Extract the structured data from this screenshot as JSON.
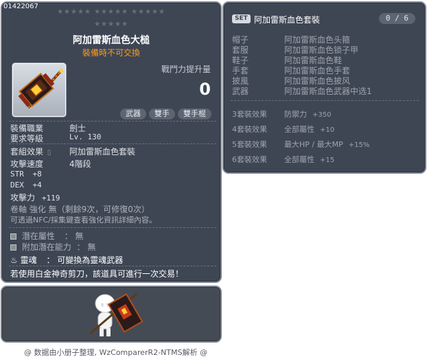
{
  "item": {
    "code": "01422067",
    "stars_row1": "★★★★★ ★★★★★ ★★★★★",
    "stars_row2": "★★★★★",
    "name": "阿加雷斯血色大槌",
    "trade_note": "裝備時不可交換",
    "power_label": "戰鬥力提升量",
    "power_value": "0",
    "tags": [
      "武器",
      "雙手",
      "雙手棍"
    ],
    "job_label": "裝備職業",
    "job_value": "劍士",
    "level_label": "要求等級",
    "level_value": "Lv. 130",
    "set_label": "套組效果",
    "set_value": "阿加雷斯血色套裝",
    "speed_label": "攻擊速度",
    "speed_value": "4階段",
    "str_label": "STR",
    "str_value": "+8",
    "dex_label": "DEX",
    "dex_value": "+4",
    "atk_label": "攻擊力",
    "atk_value": "+119",
    "scroll_note": "卷軸 強化 無（剩餘9次，可修復0次）",
    "enhance_note": "可透過NFC/採集鍵查看強化資訊詳細內容。",
    "potential_label": "潛在屬性",
    "potential_value": "： 無",
    "add_potential_label": "附加潛在能力",
    "add_potential_value": "： 無",
    "soul_label": "靈魂",
    "soul_value": "： 可變換為靈魂武器",
    "scissors_note": "若使用白金神奇剪刀，該道具可進行一次交易！"
  },
  "set": {
    "badge": "SET",
    "title": "阿加雷斯血色套裝",
    "count": "0 / 6",
    "parts": [
      {
        "slot": "帽子",
        "name": "阿加雷斯血色头箍"
      },
      {
        "slot": "套服",
        "name": "阿加雷斯血色锁子甲"
      },
      {
        "slot": "鞋子",
        "name": "阿加雷斯血色鞋"
      },
      {
        "slot": "手套",
        "name": "阿加雷斯血色手套"
      },
      {
        "slot": "披風",
        "name": "阿加雷斯血色披风"
      },
      {
        "slot": "武器",
        "name": "阿加雷斯血色武器中选1"
      }
    ],
    "effects": [
      {
        "label": "3套裝效果",
        "stat": "防禦力",
        "value": "+350"
      },
      {
        "label": "4套裝效果",
        "stat": "全部屬性",
        "value": "+10"
      },
      {
        "label": "5套裝效果",
        "stat": "最大HP / 最大MP",
        "value": "+15%"
      },
      {
        "label": "6套裝效果",
        "stat": "全部屬性",
        "value": "+15"
      }
    ]
  },
  "footer": "@ 数据由小册子整理, WzComparerR2-NTMS解析 @",
  "colors": {
    "panel": "#3e4654",
    "trade_note": "#ff9a1a",
    "border": "#7a8290"
  }
}
